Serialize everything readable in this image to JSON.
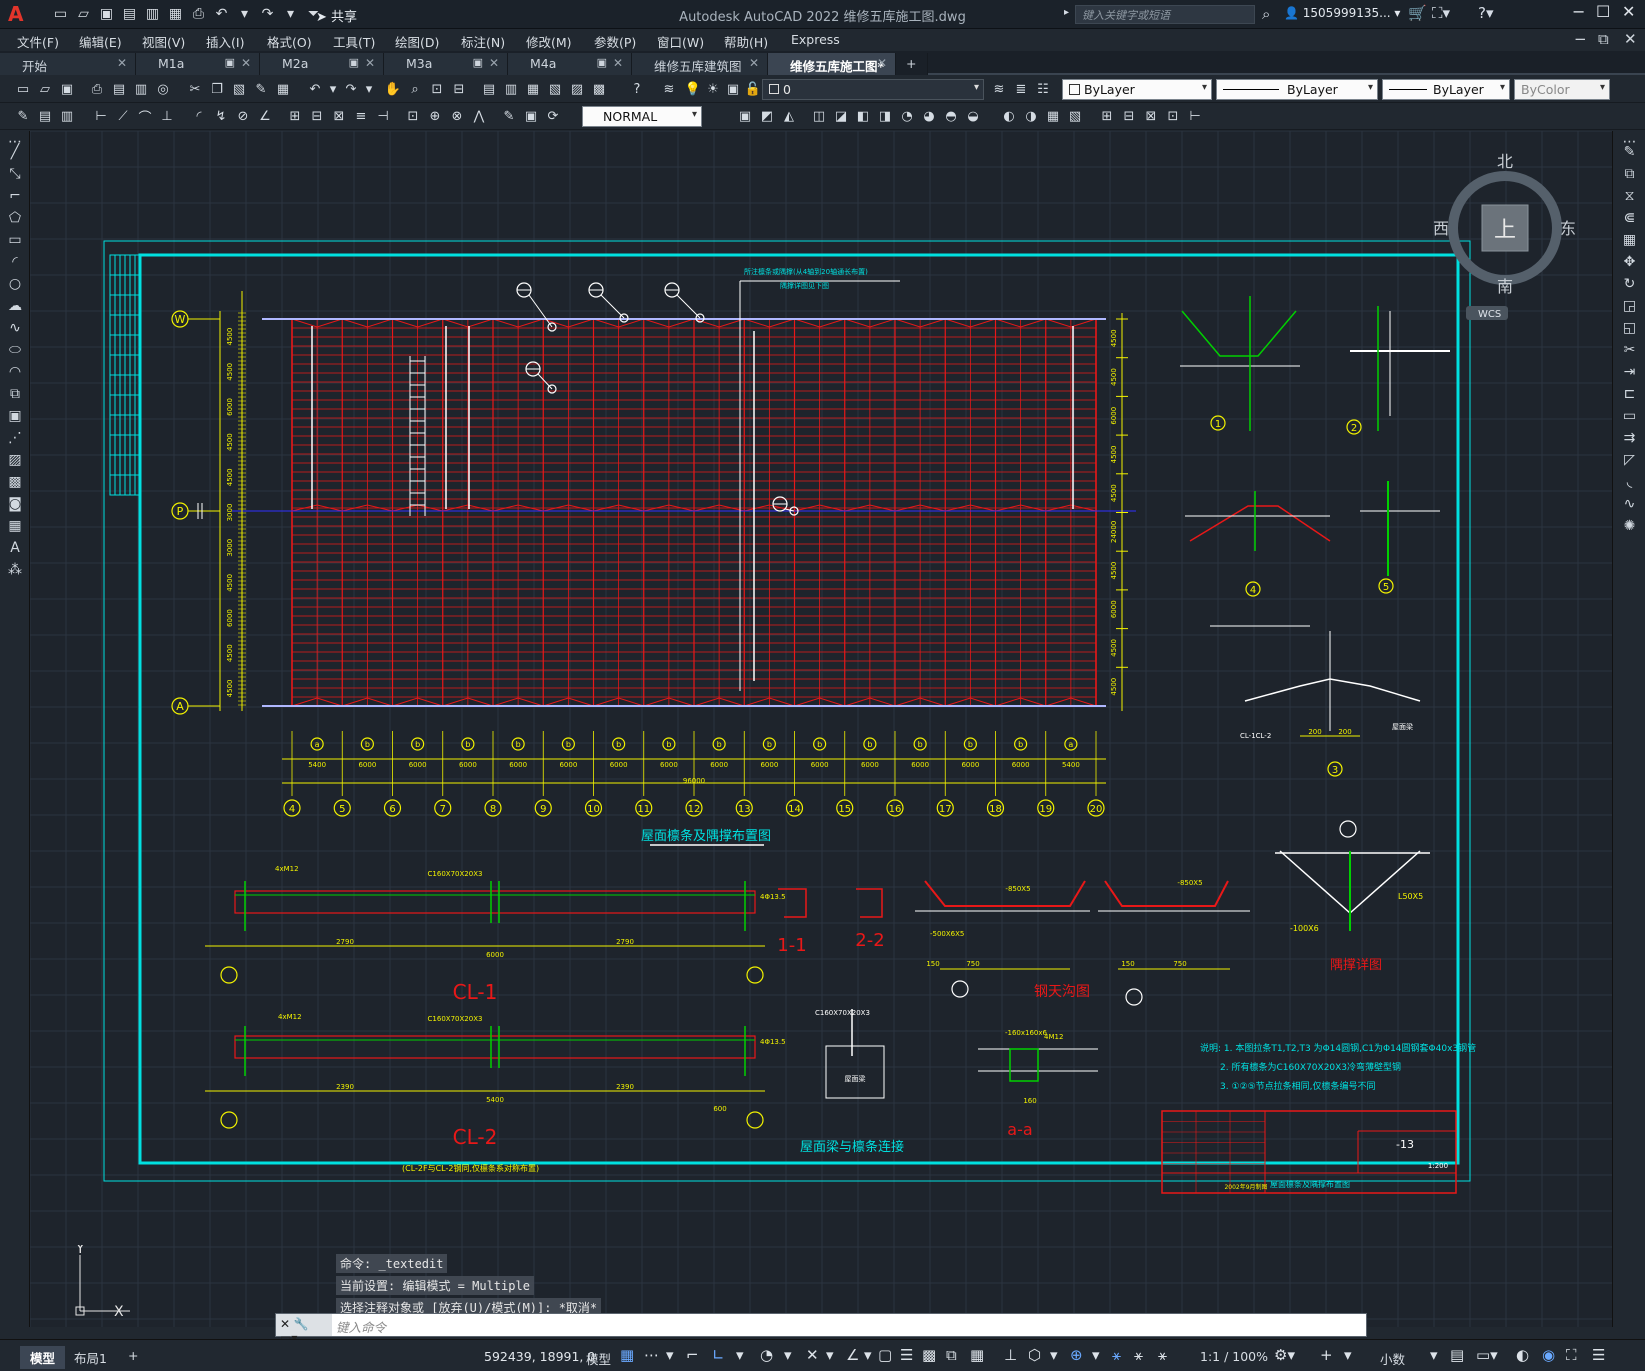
{
  "app": {
    "title": "Autodesk AutoCAD 2022    维修五库施工图.dwg",
    "share": "共享",
    "search_placeholder": "键入关键字或短语",
    "user": "1505999135...",
    "logo": "A"
  },
  "menu": [
    "文件(F)",
    "编辑(E)",
    "视图(V)",
    "插入(I)",
    "格式(O)",
    "工具(T)",
    "绘图(D)",
    "标注(N)",
    "修改(M)",
    "参数(P)",
    "窗口(W)",
    "帮助(H)",
    "Express"
  ],
  "tabs": [
    {
      "label": "开始"
    },
    {
      "label": "M1a"
    },
    {
      "label": "M2a"
    },
    {
      "label": "M3a"
    },
    {
      "label": "M4a"
    },
    {
      "label": "维修五库建筑图"
    },
    {
      "label": "维修五库施工图*"
    }
  ],
  "toolbar": {
    "layer_value": "0",
    "color_value": "ByLayer",
    "linetype_value": "ByLayer",
    "lineweight_value": "ByLayer",
    "plotstyle_value": "ByColor",
    "textstyle_value": "NORMAL"
  },
  "navcube": {
    "north": "北",
    "south": "南",
    "east": "东",
    "west": "西",
    "top": "上",
    "wcs": "WCS"
  },
  "drawing": {
    "colors": {
      "bg": "#1e242c",
      "grid": "#2b3440",
      "frame": "#00e0e0",
      "red": "#e81818",
      "yellow": "#f2f200",
      "green": "#00d000",
      "white": "#ffffff",
      "cyan": "#00e0e0",
      "blue": "#3030ff"
    },
    "plan_title": "屋面檩条及隅撑布置图",
    "plan_note1": "所注檩条或隅撑(从4轴到20轴通长布置)",
    "plan_note2": "隅撑详图见下图",
    "axes_bottom": [
      "4",
      "5",
      "6",
      "7",
      "8",
      "9",
      "10",
      "11",
      "12",
      "13",
      "14",
      "15",
      "16",
      "17",
      "18",
      "19",
      "20"
    ],
    "axes_left": [
      "W",
      "P",
      "A"
    ],
    "bay_labels": [
      "a",
      "b",
      "b",
      "b",
      "b",
      "b",
      "b",
      "b",
      "b",
      "b",
      "b",
      "b",
      "b",
      "b",
      "b",
      "a"
    ],
    "dims_bottom": [
      "5400",
      "6000",
      "6000",
      "6000",
      "6000",
      "6000",
      "6000",
      "6000",
      "6000",
      "6000",
      "6000",
      "6000",
      "6000",
      "6000",
      "6000",
      "5400"
    ],
    "dim_total": "96000",
    "dims_right": [
      "4500",
      "4500",
      "6000",
      "4500",
      "4500",
      "24000",
      "4500",
      "6000",
      "4500",
      "4500"
    ],
    "dims_left": [
      "4500",
      "4500",
      "6000",
      "4500",
      "4500",
      "3000",
      "3000",
      "4500",
      "6000",
      "4500",
      "4500"
    ],
    "cl1_title": "CL-1",
    "cl1_dims": [
      "2790",
      "2790",
      "6000"
    ],
    "cl1_top": "C160X70X20X3",
    "cl1_holes": "4xM12",
    "cl1_hole13": "4Φ13.5",
    "cl2_title": "CL-2",
    "cl2_dims": [
      "2390",
      "2390",
      "5400",
      "600"
    ],
    "cl2_top": "C160X70X20X3",
    "cl2_hole": "4Φ13.5",
    "cl2_note": "(CL-2F与CL-2钢同,仅檩条系对称布置)",
    "sec11": "1-1",
    "sec22": "2-2",
    "gutter_title": "钢天沟图",
    "gutter_dims": [
      "750",
      "750",
      "150",
      "150"
    ],
    "gutter_spec": "-500X6X5",
    "gutter_spec2": "-850X5",
    "brace_title": "隅撑详图",
    "brace_spec": "L50X5",
    "brace_plate": "-100X6",
    "conn_title": "屋面梁与檩条连接",
    "conn_spec": "C160X70X20X3",
    "conn_beam": "屋面梁",
    "aa_title": "a-a",
    "aa_spec": "-160x160x6",
    "aa_bolt": "4M12",
    "aa_dim": "160",
    "detail_labels": [
      "1",
      "2",
      "4",
      "5",
      "3"
    ],
    "detail3_dims": [
      "200",
      "200"
    ],
    "detail3_cl": "CL-1CL-2",
    "detail3_beam": "屋面梁",
    "notes": [
      "说明: 1. 本图拉条T1,T2,T3 为Φ14圆钢,C1为Φ14圆钢套Φ40x3钢管",
      "2. 所有檩条为C160X70X20X3冷弯薄壁型钢",
      "3. ①②⑤节点拉条相同,仅檩条编号不同"
    ],
    "titleblock": {
      "drawing_no": "-13",
      "scale": "1:200",
      "drawing_title": "屋面檩条及隅撑布置图",
      "date": "2002年9月制图"
    }
  },
  "command": {
    "history": [
      "命令: _textedit",
      "当前设置: 编辑模式 = Multiple",
      "选择注释对象或 [放弃(U)/模式(M)]: *取消*"
    ],
    "placeholder": "键入命令"
  },
  "status": {
    "tabs": [
      {
        "label": "模型"
      },
      {
        "label": "布局1"
      }
    ],
    "coords": "592439, 18991, 0",
    "mode": "模型",
    "scale": "1:1 / 100%",
    "units": "小数"
  },
  "ucs": {
    "y": "Y",
    "x": "X"
  }
}
